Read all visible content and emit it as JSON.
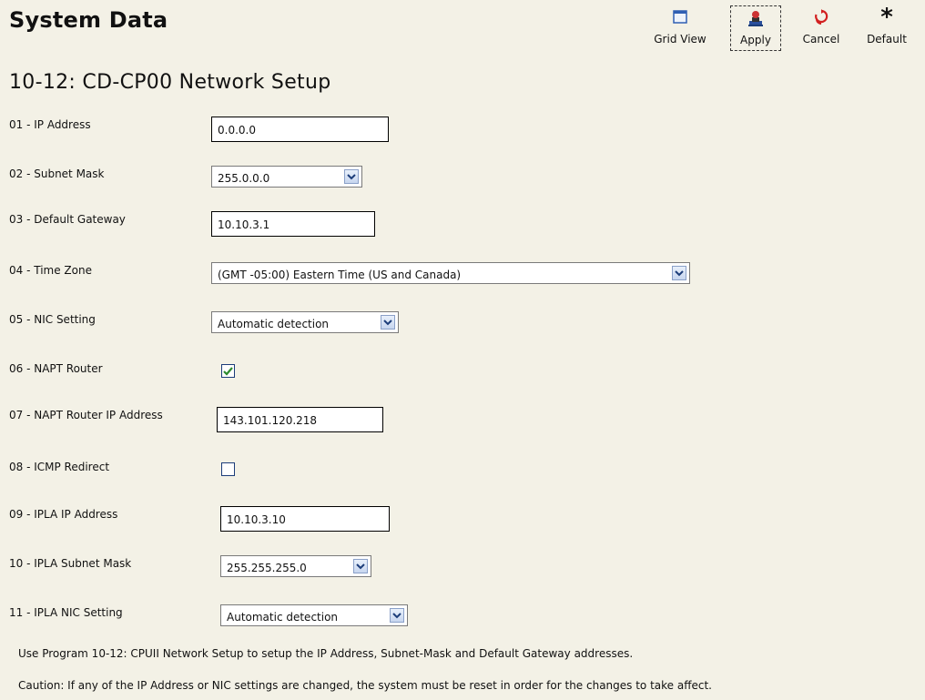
{
  "header": {
    "title": "System Data"
  },
  "toolbar": {
    "grid_view": "Grid View",
    "apply": "Apply",
    "cancel": "Cancel",
    "default": "Default"
  },
  "section": {
    "title": "10-12: CD-CP00 Network Setup"
  },
  "fields": {
    "ip_address": {
      "label": "01 - IP Address",
      "value": "0.0.0.0"
    },
    "subnet_mask": {
      "label": "02 - Subnet Mask",
      "value": "255.0.0.0"
    },
    "default_gateway": {
      "label": "03 - Default Gateway",
      "value": "10.10.3.1"
    },
    "time_zone": {
      "label": "04 - Time Zone",
      "value": "(GMT -05:00) Eastern Time (US and Canada)"
    },
    "nic_setting": {
      "label": "05 - NIC Setting",
      "value": "Automatic detection"
    },
    "napt_router": {
      "label": "06 - NAPT Router",
      "checked": true
    },
    "napt_router_ip": {
      "label": "07 - NAPT Router IP Address",
      "value": "143.101.120.218"
    },
    "icmp_redirect": {
      "label": "08 - ICMP Redirect",
      "checked": false
    },
    "ipla_ip": {
      "label": "09 - IPLA IP Address",
      "value": "10.10.3.10"
    },
    "ipla_subnet": {
      "label": "10 - IPLA Subnet Mask",
      "value": "255.255.255.0"
    },
    "ipla_nic": {
      "label": "11 - IPLA NIC Setting",
      "value": "Automatic detection"
    }
  },
  "notes": {
    "usage": "Use Program 10-12: CPUII Network Setup to setup the IP Address, Subnet-Mask and Default Gateway addresses.",
    "caution": "Caution: If any of the IP Address or NIC settings are changed, the system must be reset in order for the changes to take affect."
  },
  "colors": {
    "background": "#f3f1e6",
    "cancel_icon": "#d22020",
    "check_mark": "#2e8b2e",
    "grid_icon": "#2f5fb3"
  },
  "icons": [
    "grid-view-icon",
    "apply-icon",
    "cancel-icon",
    "default-asterisk-icon",
    "chevron-down-icon",
    "checkmark-icon"
  ]
}
